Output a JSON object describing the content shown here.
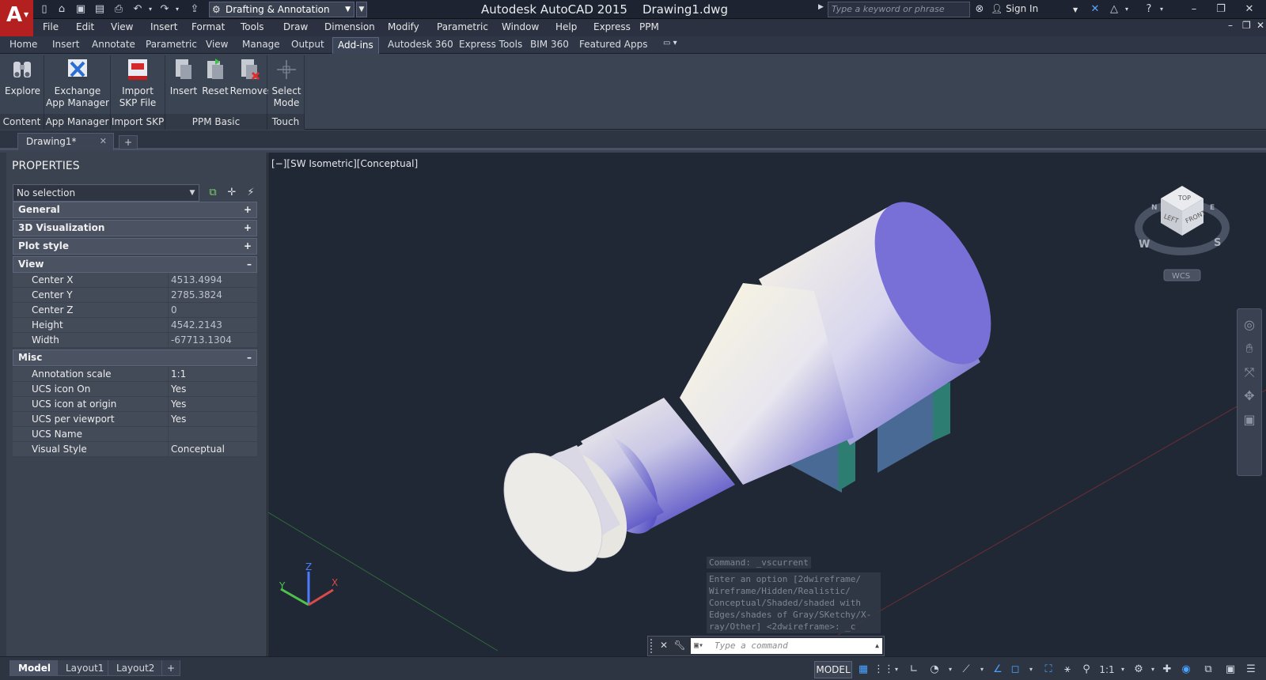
{
  "titlebar": {
    "app_letter": "A",
    "workspace": "Drafting & Annotation",
    "title": "Autodesk AutoCAD 2015    Drawing1.dwg",
    "search_placeholder": "Type a keyword or phrase",
    "signin": "Sign In"
  },
  "menu": [
    "File",
    "Edit",
    "View",
    "Insert",
    "Format",
    "Tools",
    "Draw",
    "Dimension",
    "Modify",
    "Parametric",
    "Window",
    "Help",
    "Express",
    "PPM"
  ],
  "ribbon_tabs": [
    "Home",
    "Insert",
    "Annotate",
    "Parametric",
    "View",
    "Manage",
    "Output",
    "Add-ins",
    "Autodesk 360",
    "Express Tools",
    "BIM 360",
    "Featured Apps"
  ],
  "ribbon_active_tab": "Add-ins",
  "ribbon": {
    "buttons": [
      {
        "l1": "Explore",
        "l2": ""
      },
      {
        "l1": "Exchange",
        "l2": "App Manager"
      },
      {
        "l1": "Import",
        "l2": "SKP File"
      },
      {
        "l1": "Insert",
        "l2": ""
      },
      {
        "l1": "Reset",
        "l2": ""
      },
      {
        "l1": "Remove",
        "l2": ""
      },
      {
        "l1": "Select",
        "l2": "Mode"
      }
    ],
    "groups": [
      "Content",
      "App Manager",
      "Import SKP",
      "PPM Basic",
      "Touch"
    ]
  },
  "file_tabs": {
    "drawing": "Drawing1*",
    "new": "+"
  },
  "properties": {
    "title": "PROPERTIES",
    "selection": "No selection",
    "categories": {
      "general": "General",
      "viz": "3D Visualization",
      "plot": "Plot style",
      "view": "View",
      "misc": "Misc"
    },
    "view_rows": [
      {
        "k": "Center X",
        "v": "4513.4994"
      },
      {
        "k": "Center Y",
        "v": "2785.3824"
      },
      {
        "k": "Center Z",
        "v": "0"
      },
      {
        "k": "Height",
        "v": "4542.2143"
      },
      {
        "k": "Width",
        "v": "-67713.1304"
      }
    ],
    "misc_rows": [
      {
        "k": "Annotation scale",
        "v": "1:1"
      },
      {
        "k": "UCS icon On",
        "v": "Yes"
      },
      {
        "k": "UCS icon at origin",
        "v": "Yes"
      },
      {
        "k": "UCS per viewport",
        "v": "Yes"
      },
      {
        "k": "UCS Name",
        "v": ""
      },
      {
        "k": "Visual Style",
        "v": "Conceptual"
      }
    ]
  },
  "viewport": {
    "label": "[−][SW Isometric][Conceptual]",
    "viewcube": {
      "top": "TOP",
      "left": "LEFT",
      "front": "FRONT",
      "w": "W",
      "s": "S",
      "e": "E",
      "n": "N",
      "wcs": "WCS"
    },
    "ucs": {
      "x": "X",
      "y": "Y",
      "z": "Z"
    }
  },
  "command": {
    "history1": "Command: _vscurrent",
    "history2": "Enter an option [2dwireframe/\nWireframe/Hidden/Realistic/\nConceptual/Shaded/shaded with\nEdges/shades of Gray/SKetchy/X-\nray/Other] <2dwireframe>: _c",
    "placeholder": "Type a command"
  },
  "status": {
    "layouts": [
      "Model",
      "Layout1",
      "Layout2"
    ],
    "add": "+",
    "model_btn": "MODEL",
    "scale": "1:1"
  },
  "colors": {
    "accent": "#4aa3ff",
    "app_red": "#b41f1f",
    "viewport_bg": "#212835"
  }
}
